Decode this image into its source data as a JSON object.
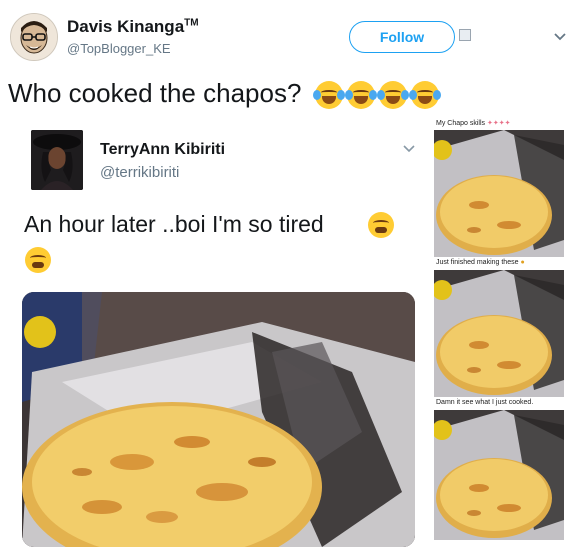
{
  "header": {
    "name": "Davis Kinanga",
    "tm": "TM",
    "handle": "@TopBlogger_KE",
    "follow_label": "Follow"
  },
  "tweet": {
    "text": "Who cooked the chapos?",
    "emoji": [
      "face-with-tears-of-joy",
      "face-with-tears-of-joy",
      "face-with-tears-of-joy",
      "face-with-tears-of-joy"
    ]
  },
  "embedded": {
    "name": "TerryAnn Kibiriti",
    "handle": "@terrikibiriti",
    "text": "An hour later ..boi I'm so tired",
    "emoji": [
      "tired-face",
      "tired-face"
    ]
  },
  "strip": {
    "captions": [
      "My Chapo skills",
      "Just finished making these",
      "Damn it see what I just cooked."
    ],
    "caption_emoji": [
      "chef-emoji",
      "raised-hands-emoji"
    ]
  },
  "colors": {
    "accent": "#1da1f2",
    "text": "#14171a",
    "muted": "#657786"
  }
}
